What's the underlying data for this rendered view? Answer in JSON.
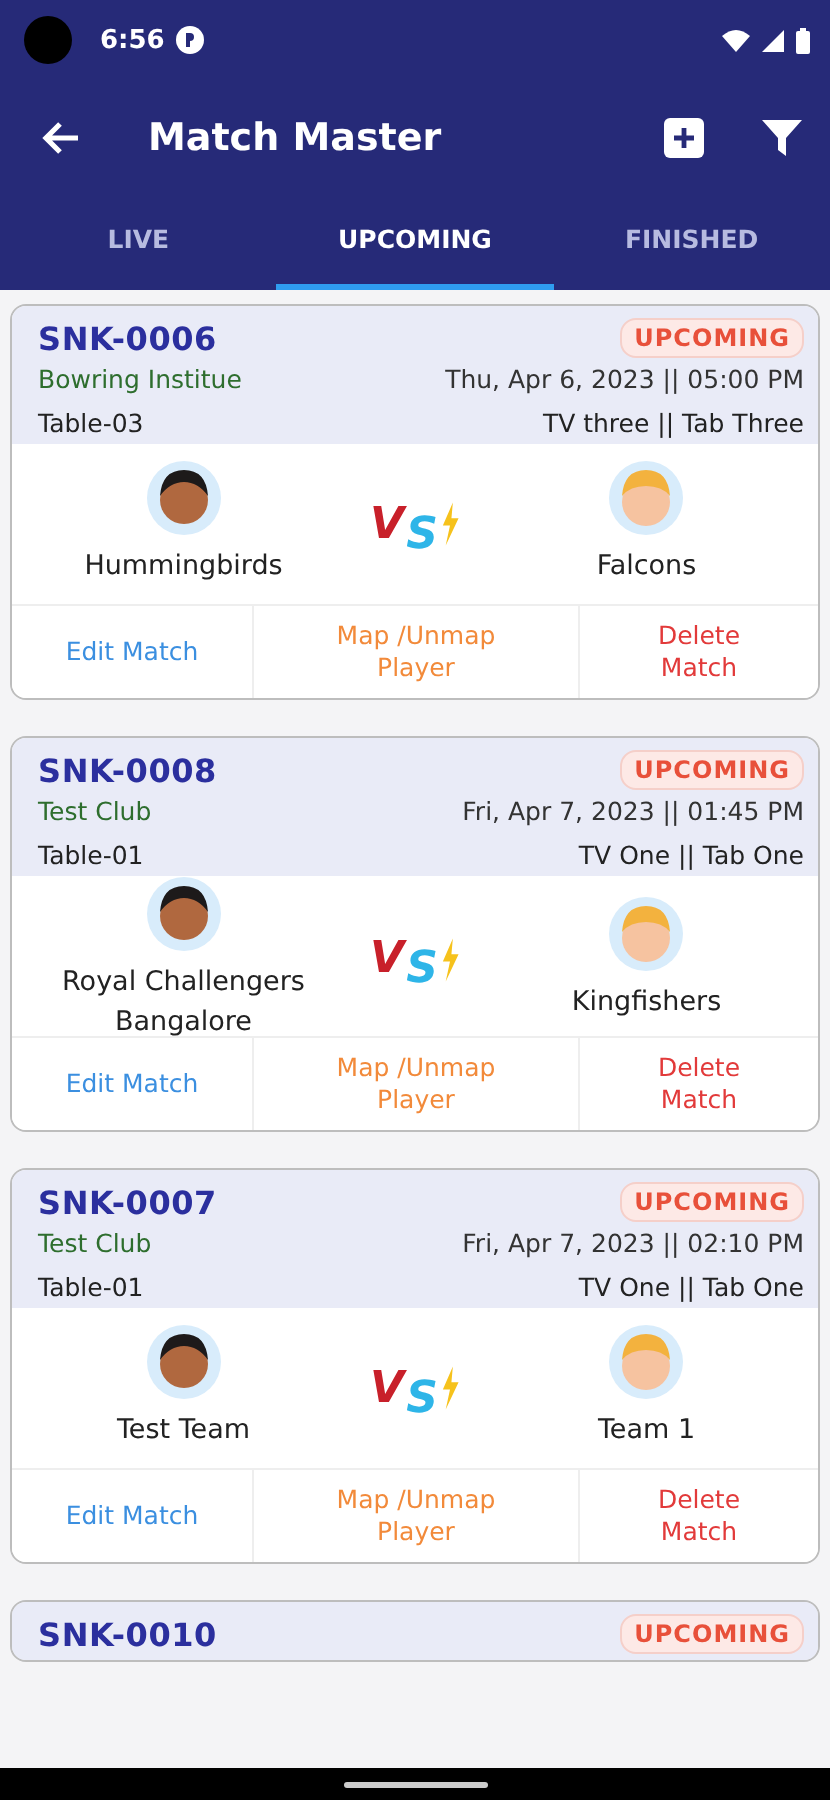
{
  "status_bar": {
    "time": "6:56"
  },
  "app_bar": {
    "title": "Match Master"
  },
  "tabs": [
    {
      "label": "LIVE",
      "selected": false
    },
    {
      "label": "UPCOMING",
      "selected": true
    },
    {
      "label": "FINISHED",
      "selected": false
    }
  ],
  "matches": [
    {
      "id": "SNK-0006",
      "status": "UPCOMING",
      "venue": "Bowring Institue",
      "datetime": "Thu, Apr 6, 2023 || 05:00 PM",
      "table": "Table-03",
      "screens": "TV three  ||  Tab Three",
      "home_team": "Hummingbirds",
      "vs": "VS",
      "away_team": "Falcons",
      "actions": [
        "Edit Match",
        "Map /Unmap Player",
        "Delete Match"
      ]
    },
    {
      "id": "SNK-0008",
      "status": "UPCOMING",
      "venue": "Test Club",
      "datetime": "Fri, Apr 7, 2023 || 01:45 PM",
      "table": "Table-01",
      "screens": "TV One  ||  Tab One",
      "home_team": "Royal Challengers Bangalore",
      "vs": "VS",
      "away_team": "Kingfishers",
      "actions": [
        "Edit Match",
        "Map /Unmap Player",
        "Delete Match"
      ]
    },
    {
      "id": "SNK-0007",
      "status": "UPCOMING",
      "venue": "Test Club",
      "datetime": "Fri, Apr 7, 2023 || 02:10 PM",
      "table": "Table-01",
      "screens": "TV One  ||  Tab One",
      "home_team": "Test Team",
      "vs": "VS",
      "away_team": "Team 1",
      "actions": [
        "Edit Match",
        "Map /Unmap Player",
        "Delete Match"
      ]
    },
    {
      "id": "SNK-0010",
      "status": "UPCOMING"
    }
  ]
}
